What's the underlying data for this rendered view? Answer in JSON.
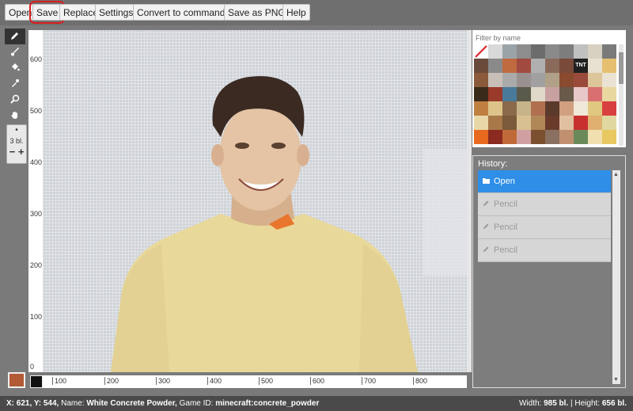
{
  "toolbar": {
    "open": "Open",
    "save": "Save",
    "replace": "Replace",
    "settings": "Settings",
    "convert": "Convert to commands..",
    "save_png": "Save as PNG..",
    "help": "Help"
  },
  "brush": {
    "size_label": "3 bl.",
    "minus": "−",
    "plus": "+"
  },
  "ruler": {
    "vertical": [
      "600",
      "500",
      "400",
      "300",
      "200",
      "100",
      "0"
    ],
    "horizontal": [
      "100",
      "200",
      "300",
      "400",
      "500",
      "600",
      "700",
      "800"
    ]
  },
  "palette": {
    "filter_placeholder": "Filter by name",
    "tnt_label": "TNT",
    "tile_colors": [
      "#ffffff",
      "#d9d9d9",
      "#9aa3a8",
      "#8d8d8d",
      "#6c6c6c",
      "#8a8a8a",
      "#7d7d7d",
      "#c0c0c0",
      "#d8d0c0",
      "#7a7a7a",
      "#6a4a3a",
      "#8a8a8a",
      "#c06a40",
      "#a04a40",
      "#b0b0b0",
      "#8a6a5a",
      "#7a4a3a",
      "#202020",
      "#e8e0d0",
      "#e6c070",
      "#8a5a3a",
      "#c8c0b8",
      "#aaaaaa",
      "#9a9090",
      "#a0a0a0",
      "#b0a088",
      "#8a4a30",
      "#9a4a3a",
      "#dcc69a",
      "#eae2d2",
      "#3a2a1a",
      "#9a3a2a",
      "#4a7a9a",
      "#5a5a4a",
      "#e0d8c8",
      "#c8a0a0",
      "#6a5a4a",
      "#e8c8c8",
      "#d87070",
      "#e8d8a0",
      "#c08040",
      "#dcc48a",
      "#8a6a4a",
      "#c8b48a",
      "#b07050",
      "#5a3a2a",
      "#d0a080",
      "#f0e8d8",
      "#e0c880",
      "#d84040",
      "#e8d8a8",
      "#a87848",
      "#7a5a3a",
      "#d8c090",
      "#b08858",
      "#6a3a2a",
      "#e0c0a0",
      "#c83030",
      "#e0b070",
      "#e0d8a0",
      "#e86a20",
      "#8a2a20",
      "#c06a3a",
      "#d0a0a0",
      "#7a5030",
      "#8a7060",
      "#c09070",
      "#6a8a5a",
      "#f0e0b0",
      "#e8c860"
    ]
  },
  "history": {
    "title": "History:",
    "items": [
      {
        "label": "Open",
        "active": true
      },
      {
        "label": "Pencil",
        "active": false
      },
      {
        "label": "Pencil",
        "active": false
      },
      {
        "label": "Pencil",
        "active": false
      }
    ]
  },
  "status": {
    "coords": "X: 621, Y: 544,",
    "name_label": "Name:",
    "name_value": "White Concrete Powder,",
    "game_id_label": "Game ID:",
    "game_id_value": "minecraft:concrete_powder",
    "width_label": "Width:",
    "width_value": "985 bl.",
    "height_label": "Height:",
    "height_value": "656 bl."
  },
  "colors": {
    "primary_swatch": "#b15a35",
    "secondary_swatch": "#111111",
    "history_active": "#2e8ee8"
  },
  "icons": [
    "pencil-icon",
    "brush-icon",
    "fill-bucket-icon",
    "eyedropper-icon",
    "zoom-icon",
    "hand-icon",
    "folder-icon"
  ]
}
